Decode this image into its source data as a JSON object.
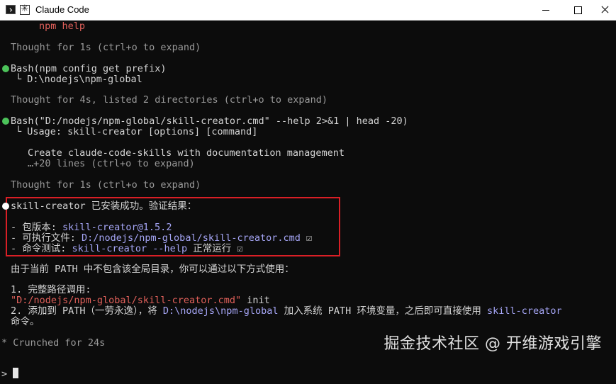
{
  "window": {
    "title": "Claude Code"
  },
  "terminal": {
    "npm_help": "npm help",
    "thought1": "Thought for 1s (ctrl+o to expand)",
    "bash1_cmd": "Bash(npm config get prefix)",
    "bash1_out": "└ D:\\nodejs\\npm-global",
    "thought2": "Thought for 4s, listed 2 directories (ctrl+o to expand)",
    "bash2_cmd": "Bash(\"D:/nodejs/npm-global/skill-creator.cmd\" --help 2>&1 | head -20)",
    "bash2_out": "└ Usage: skill-creator [options] [command]",
    "create_desc": "Create claude-code-skills with documentation management",
    "more_lines": "…+20 lines (ctrl+o to expand)",
    "thought3": "Thought for 1s (ctrl+o to expand)",
    "result_title": "skill-creator 已安装成功。验证结果：",
    "result_items": [
      {
        "label": "- 包版本: ",
        "value": "skill-creator@1.5.2",
        "check": ""
      },
      {
        "label": "- 可执行文件: ",
        "value": "D:/nodejs/npm-global/skill-creator.cmd",
        "check": " ☑"
      },
      {
        "label": "- 命令测试: ",
        "value": "skill-creator --help",
        "suffix": " 正常运行",
        "check": " ☑"
      }
    ],
    "path_note": "由于当前 PATH 中不包含该全局目录，你可以通过以下方式使用：",
    "opt1_label": "1. 完整路径调用:",
    "opt1_path": "\"D:/nodejs/npm-global/skill-creator.cmd\"",
    "opt1_arg": " init",
    "opt2_pre": "2. 添加到 PATH（一劳永逸），将 ",
    "opt2_path": "D:\\nodejs\\npm-global",
    "opt2_mid": " 加入系统 PATH 环境变量，之后即可直接使用 ",
    "opt2_cmd": "skill-creator",
    "opt2_cont": "命令。",
    "crunched": "* Crunched for 24s",
    "prompt": ">"
  },
  "watermark": "掘金技术社区 @ 开维游戏引擎"
}
